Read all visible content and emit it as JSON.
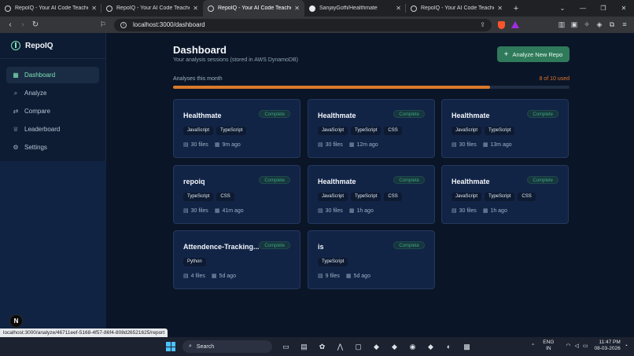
{
  "browser": {
    "tabs": [
      {
        "title": "RepoIQ - Your AI Code Teacher",
        "favicon": "globe-icon",
        "active": false
      },
      {
        "title": "RepoIQ - Your AI Code Teacher",
        "favicon": "globe-icon",
        "active": false
      },
      {
        "title": "RepoIQ - Your AI Code Teacher",
        "favicon": "globe-icon",
        "active": true
      },
      {
        "title": "SanjayGoffi/Healthmate",
        "favicon": "github-icon",
        "active": false
      },
      {
        "title": "RepoIQ - Your AI Code Teacher",
        "favicon": "globe-icon",
        "active": false
      }
    ],
    "url": "localhost:3000/dashboard",
    "status_url": "localhost:3000/analyze/46711eef-5168-4f57-86f4-808d26521625/report"
  },
  "sidebar": {
    "brand": "RepoIQ",
    "items": [
      {
        "label": "Dashboard",
        "icon": "grid-icon",
        "active": true
      },
      {
        "label": "Analyze",
        "icon": "search-icon",
        "active": false
      },
      {
        "label": "Compare",
        "icon": "compare-icon",
        "active": false
      },
      {
        "label": "Leaderboard",
        "icon": "trophy-icon",
        "active": false
      },
      {
        "label": "Settings",
        "icon": "gear-icon",
        "active": false
      }
    ],
    "badge": "N"
  },
  "header": {
    "title": "Dashboard",
    "subtitle": "Your analysis sessions (stored in AWS DynamoDB)",
    "analyze_button": "Analyze New Repo"
  },
  "usage": {
    "label": "Analyses this month",
    "count_text": "8 of 10 used",
    "used": 8,
    "limit": 10,
    "bar_color": "#d97a2c"
  },
  "sessions": [
    {
      "name": "Healthmate",
      "status": "Complete",
      "tags": [
        "JavaScript",
        "TypeScript"
      ],
      "files": "30 files",
      "ago": "9m ago"
    },
    {
      "name": "Healthmate",
      "status": "Complete",
      "tags": [
        "JavaScript",
        "TypeScript",
        "CSS"
      ],
      "files": "30 files",
      "ago": "12m ago"
    },
    {
      "name": "Healthmate",
      "status": "Complete",
      "tags": [
        "JavaScript",
        "TypeScript"
      ],
      "files": "30 files",
      "ago": "13m ago"
    },
    {
      "name": "repoiq",
      "status": "Complete",
      "tags": [
        "TypeScript",
        "CSS"
      ],
      "files": "30 files",
      "ago": "41m ago"
    },
    {
      "name": "Healthmate",
      "status": "Complete",
      "tags": [
        "JavaScript",
        "TypeScript",
        "CSS"
      ],
      "files": "30 files",
      "ago": "1h ago"
    },
    {
      "name": "Healthmate",
      "status": "Complete",
      "tags": [
        "JavaScript",
        "TypeScript",
        "CSS"
      ],
      "files": "30 files",
      "ago": "1h ago"
    },
    {
      "name": "Attendence-Tracking...",
      "status": "Complete",
      "tags": [
        "Python"
      ],
      "files": "4 files",
      "ago": "5d ago"
    },
    {
      "name": "is",
      "status": "Complete",
      "tags": [
        "TypeScript"
      ],
      "files": "9 files",
      "ago": "5d ago"
    }
  ],
  "taskbar": {
    "search": "Search",
    "lang_line1": "ENG",
    "lang_line2": "IN",
    "time": "11:47 PM",
    "date": "08-03-2026"
  },
  "colors": {
    "accent": "#7fe3b8",
    "button": "#2f7a5a",
    "warning": "#e0762b"
  }
}
